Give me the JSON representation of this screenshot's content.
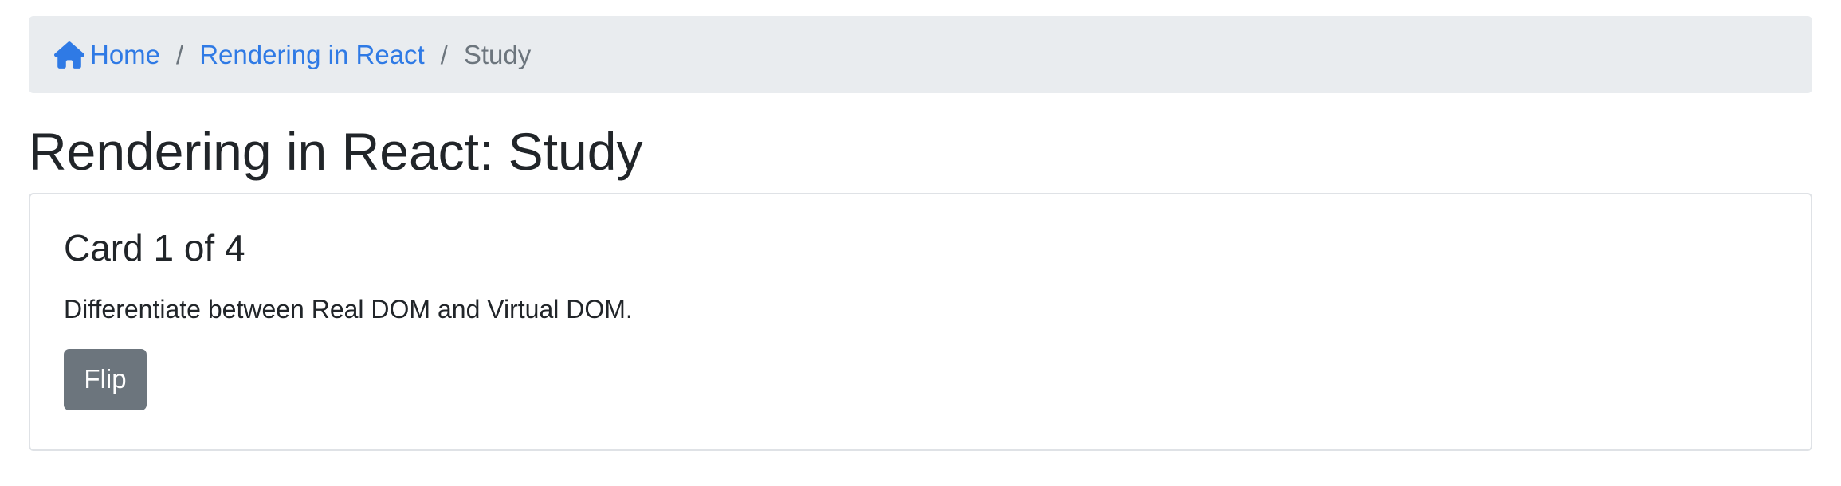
{
  "breadcrumb": {
    "home_label": "Home",
    "home_icon": "home-icon",
    "deck_label": "Rendering in React",
    "current_label": "Study",
    "separator": "/"
  },
  "page": {
    "title": "Rendering in React: Study"
  },
  "card": {
    "title": "Card 1 of 4",
    "text": "Differentiate between Real DOM and Virtual DOM.",
    "flip_label": "Flip"
  },
  "colors": {
    "link": "#2f7ae5",
    "breadcrumb_bg": "#e9ecef",
    "button_bg": "#6c757d"
  }
}
